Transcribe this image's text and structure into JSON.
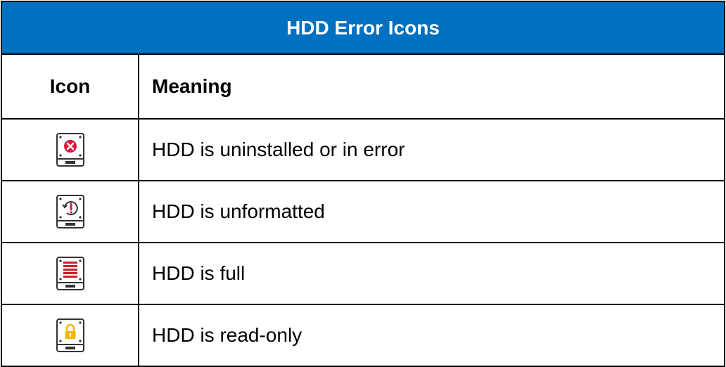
{
  "table": {
    "title": "HDD Error Icons",
    "headers": {
      "icon": "Icon",
      "meaning": "Meaning"
    },
    "rows": [
      {
        "icon": "hdd-error-icon",
        "meaning": "HDD is uninstalled or in error"
      },
      {
        "icon": "hdd-unformatted-icon",
        "meaning": "HDD is unformatted"
      },
      {
        "icon": "hdd-full-icon",
        "meaning": "HDD is full"
      },
      {
        "icon": "hdd-read-only-icon",
        "meaning": "HDD is read-only"
      }
    ]
  },
  "colors": {
    "title_background": "#0070c0",
    "title_text": "#ffffff",
    "error_red": "#e0173f",
    "full_red": "#d01c2a",
    "lock_yellow": "#f2b705"
  }
}
